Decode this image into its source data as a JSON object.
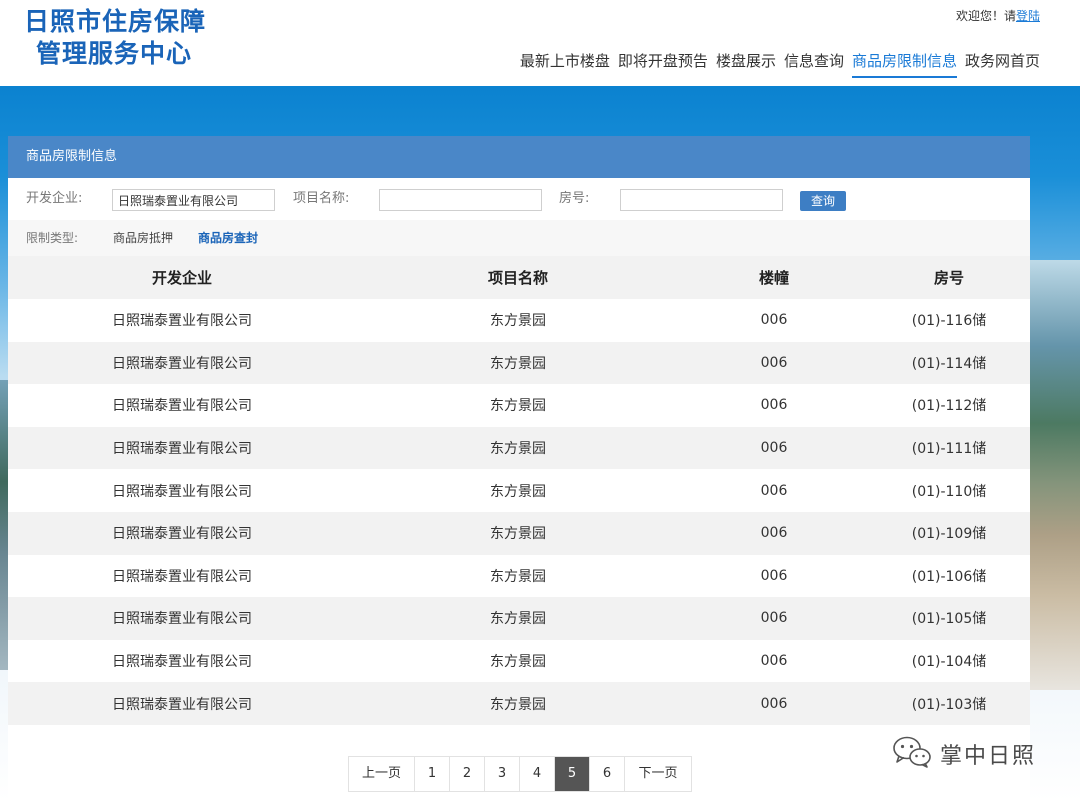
{
  "header": {
    "logo_line1": "日照市住房保障",
    "logo_line2": "管理服务中心",
    "welcome_text": "欢迎您！请",
    "login_link": "登陆",
    "nav": [
      {
        "label": "最新上市楼盘"
      },
      {
        "label": "即将开盘预告"
      },
      {
        "label": "楼盘展示"
      },
      {
        "label": "信息查询"
      },
      {
        "label": "商品房限制信息",
        "active": true
      },
      {
        "label": "政务网首页"
      }
    ]
  },
  "panel": {
    "title": "商品房限制信息",
    "filters": {
      "developer_label": "开发企业:",
      "developer_value": "日照瑞泰置业有限公司",
      "project_label": "项目名称:",
      "project_value": "",
      "room_label": "房号:",
      "room_value": "",
      "search_button": "查询"
    },
    "restriction": {
      "label": "限制类型:",
      "options": [
        {
          "label": "商品房抵押",
          "active": false
        },
        {
          "label": "商品房查封",
          "active": true
        }
      ]
    },
    "table": {
      "headers": [
        "开发企业",
        "项目名称",
        "楼幢",
        "房号"
      ],
      "rows": [
        [
          "日照瑞泰置业有限公司",
          "东方景园",
          "006",
          "(01)-116储"
        ],
        [
          "日照瑞泰置业有限公司",
          "东方景园",
          "006",
          "(01)-114储"
        ],
        [
          "日照瑞泰置业有限公司",
          "东方景园",
          "006",
          "(01)-112储"
        ],
        [
          "日照瑞泰置业有限公司",
          "东方景园",
          "006",
          "(01)-111储"
        ],
        [
          "日照瑞泰置业有限公司",
          "东方景园",
          "006",
          "(01)-110储"
        ],
        [
          "日照瑞泰置业有限公司",
          "东方景园",
          "006",
          "(01)-109储"
        ],
        [
          "日照瑞泰置业有限公司",
          "东方景园",
          "006",
          "(01)-106储"
        ],
        [
          "日照瑞泰置业有限公司",
          "东方景园",
          "006",
          "(01)-105储"
        ],
        [
          "日照瑞泰置业有限公司",
          "东方景园",
          "006",
          "(01)-104储"
        ],
        [
          "日照瑞泰置业有限公司",
          "东方景园",
          "006",
          "(01)-103储"
        ]
      ]
    },
    "pagination": {
      "prev": "上一页",
      "pages": [
        "1",
        "2",
        "3",
        "4",
        "5",
        "6"
      ],
      "current": "5",
      "next": "下一页"
    }
  },
  "watermark": {
    "text": "掌中日照",
    "icon": "wechat-icon"
  },
  "colors": {
    "brand_blue": "#1a64b8",
    "panel_header": "#4a87c8",
    "link_blue": "#1a7ad6",
    "button_blue": "#3d7ec4",
    "current_page": "#555555"
  }
}
